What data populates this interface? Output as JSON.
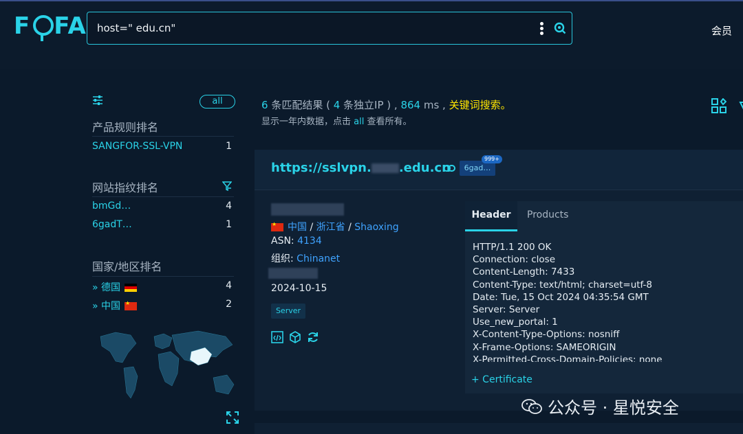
{
  "header": {
    "logo_text": "FOFA",
    "query": "host=\"        edu.cn\"",
    "member_label": "会员"
  },
  "sidebar": {
    "all_label": "all",
    "product_section": {
      "title": "产品规则排名",
      "items": [
        {
          "label": "SANGFOR-SSL-VPN",
          "count": "1"
        }
      ]
    },
    "fingerprint_section": {
      "title": "网站指纹排名",
      "items": [
        {
          "label": "bmGd…",
          "count": "4"
        },
        {
          "label": "6gadT…",
          "count": "1"
        }
      ]
    },
    "country_section": {
      "title": "国家/地区排名",
      "items": [
        {
          "label": "德国",
          "count": "4"
        },
        {
          "label": "中国",
          "count": "2"
        }
      ]
    }
  },
  "summary": {
    "results": "6",
    "results_text": " 条匹配结果 ( ",
    "ips": "4",
    "ips_text": " 条独立IP ) ,  ",
    "ms": "864",
    "ms_text": " ms ,  ",
    "keyword_link": "关键词搜索。",
    "sub_prefix": "显示一年内数据，点击 ",
    "sub_all": "all",
    "sub_suffix": " 查看所有。"
  },
  "result": {
    "url_prefix": "https://sslvpn.",
    "url_suffix": ".edu.cn",
    "tag_label": "6gad…",
    "tag_badge": "999+",
    "country": "中国",
    "province": "浙江省",
    "city": "Shaoxing",
    "sep": "/",
    "asn_label": "ASN: ",
    "asn": "4134",
    "org_label": "组织: ",
    "org": "Chinanet",
    "date": "2024-10-15",
    "server_badge": "Server",
    "tabs": [
      "Header",
      "Products"
    ],
    "header_lines": [
      "HTTP/1.1 200 OK",
      "Connection: close",
      "Content-Length: 7433",
      "Content-Type: text/html; charset=utf-8",
      "Date: Tue, 15 Oct 2024 04:35:54 GMT",
      "Server: Server",
      "Use_new_portal: 1",
      "X-Content-Type-Options: nosniff",
      "X-Frame-Options: SAMEORIGIN",
      "X-Permitted-Cross-Domain-Policies: none"
    ],
    "certificate_label": "+ Certificate"
  },
  "watermark": "公众号 · 星悦安全",
  "colors": {
    "accent": "#2ad3e8",
    "keyword": "#ffe500",
    "link": "#3fa3ff",
    "background": "#0b1a2b"
  }
}
